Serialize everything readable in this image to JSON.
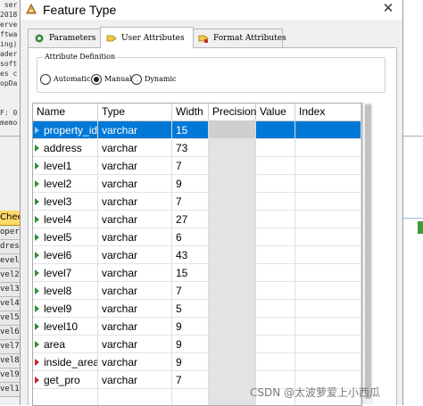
{
  "background": {
    "code_lines": [
      " ser",
      "2018",
      "erve",
      "ftwa",
      "ing)",
      "ader",
      "soft",
      "es c",
      "opDa",
      "",
      "",
      "F: 0",
      "memo"
    ],
    "sheet_tab": "Chee",
    "sheet_rows": [
      "oper",
      "dres",
      "evel",
      "vel2",
      "vel3",
      "vel4",
      "vel5",
      "vel6",
      "vel7",
      "vel8",
      "vel9",
      "vel1"
    ]
  },
  "window": {
    "title": "Feature Type",
    "close_glyph": "✕",
    "app_icon": "fme-feature-type-icon"
  },
  "tabs": [
    {
      "label": "Parameters",
      "icon": "gear-icon",
      "active": false
    },
    {
      "label": "User Attributes",
      "icon": "attribute-icon",
      "active": true
    },
    {
      "label": "Format Attributes",
      "icon": "format-icon",
      "active": false
    }
  ],
  "attribute_definition": {
    "label": "Attribute Definition",
    "options": [
      {
        "label": "Automatic",
        "selected": false
      },
      {
        "label": "Manual",
        "selected": true
      },
      {
        "label": "Dynamic",
        "selected": false
      }
    ]
  },
  "table": {
    "columns": [
      "Name",
      "Type",
      "Width",
      "Precision",
      "Value",
      "Index"
    ],
    "rows": [
      {
        "name": "property_id",
        "type": "varchar",
        "width": "15",
        "icon": "selected",
        "selected": true
      },
      {
        "name": "address",
        "type": "varchar",
        "width": "73",
        "icon": "green-arrow"
      },
      {
        "name": "level1",
        "type": "varchar",
        "width": "7",
        "icon": "green-arrow"
      },
      {
        "name": "level2",
        "type": "varchar",
        "width": "9",
        "icon": "green-arrow"
      },
      {
        "name": "level3",
        "type": "varchar",
        "width": "7",
        "icon": "green-arrow"
      },
      {
        "name": "level4",
        "type": "varchar",
        "width": "27",
        "icon": "green-arrow"
      },
      {
        "name": "level5",
        "type": "varchar",
        "width": "6",
        "icon": "green-arrow"
      },
      {
        "name": "level6",
        "type": "varchar",
        "width": "43",
        "icon": "green-arrow"
      },
      {
        "name": "level7",
        "type": "varchar",
        "width": "15",
        "icon": "green-arrow"
      },
      {
        "name": "level8",
        "type": "varchar",
        "width": "7",
        "icon": "green-arrow"
      },
      {
        "name": "level9",
        "type": "varchar",
        "width": "5",
        "icon": "green-arrow"
      },
      {
        "name": "level10",
        "type": "varchar",
        "width": "9",
        "icon": "green-arrow"
      },
      {
        "name": "area",
        "type": "varchar",
        "width": "9",
        "icon": "green-arrow"
      },
      {
        "name": "inside_area",
        "type": "varchar",
        "width": "9",
        "icon": "red-arrow"
      },
      {
        "name": "get_pro",
        "type": "varchar",
        "width": "7",
        "icon": "red-arrow"
      }
    ]
  },
  "watermark": "CSDN @太波萝爱上小西瓜",
  "colors": {
    "selection": "#0078d7",
    "disabled_cell": "#e3e3e3",
    "green_arrow": "#2f8f2f",
    "red_arrow": "#cc2222"
  }
}
